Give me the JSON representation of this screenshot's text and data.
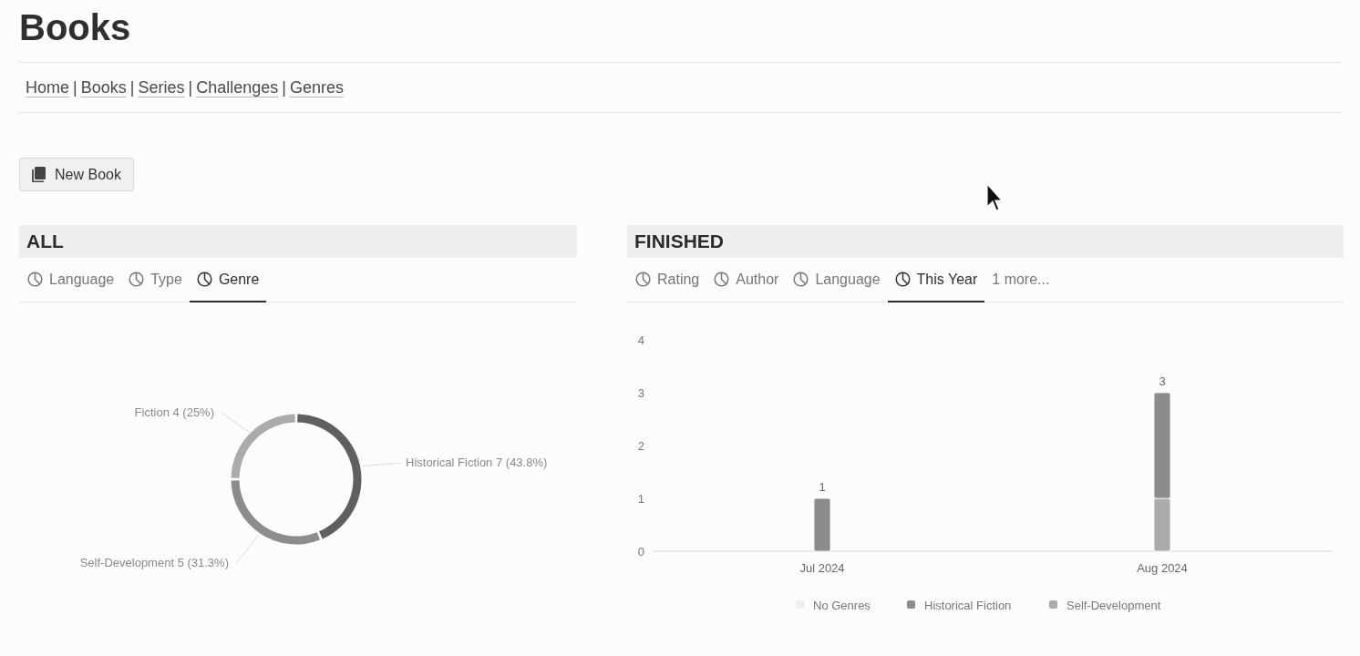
{
  "page": {
    "title": "Books"
  },
  "nav": {
    "separator": "|",
    "links": [
      {
        "label": "Home"
      },
      {
        "label": "Books"
      },
      {
        "label": "Series"
      },
      {
        "label": "Challenges"
      },
      {
        "label": "Genres"
      }
    ]
  },
  "new_button": {
    "label": "New Book"
  },
  "panels": [
    {
      "title": "ALL",
      "tabs": [
        {
          "label": "Language",
          "kind": "view",
          "selected": false
        },
        {
          "label": "Type",
          "kind": "view",
          "selected": false
        },
        {
          "label": "Genre",
          "kind": "view",
          "selected": true
        }
      ],
      "chart_data": {
        "type": "donut",
        "categories": [
          "Historical Fiction",
          "Self-Development",
          "Fiction"
        ],
        "values": [
          7,
          5,
          4
        ],
        "colors": [
          "#5f5f5f",
          "#8c8c8c",
          "#ababab"
        ],
        "value_labels": [
          "7 (43.8%)",
          "5 (31.3%)",
          "4 (25%)"
        ]
      }
    },
    {
      "title": "FINISHED",
      "tabs": [
        {
          "label": "Rating",
          "kind": "view",
          "selected": false
        },
        {
          "label": "Author",
          "kind": "view",
          "selected": false
        },
        {
          "label": "Language",
          "kind": "view",
          "selected": false
        },
        {
          "label": "This Year",
          "kind": "view",
          "selected": true
        },
        {
          "label": "1 more...",
          "kind": "more",
          "selected": false
        }
      ],
      "chart_data": {
        "type": "bar",
        "stacked": true,
        "categories": [
          "Jul 2024",
          "Aug 2024"
        ],
        "ylim": [
          0,
          4
        ],
        "yticks": [
          0,
          1,
          2,
          3,
          4
        ],
        "value_labels": [
          "1",
          "3"
        ],
        "legend": "bottom",
        "series": [
          {
            "name": "No Genres",
            "color": "#eeeeee",
            "values": [
              0,
              0
            ]
          },
          {
            "name": "Historical Fiction",
            "color": "#8c8c8c",
            "values": [
              1,
              2
            ]
          },
          {
            "name": "Self-Development",
            "color": "#ababab",
            "values": [
              0,
              1
            ]
          }
        ]
      }
    }
  ]
}
